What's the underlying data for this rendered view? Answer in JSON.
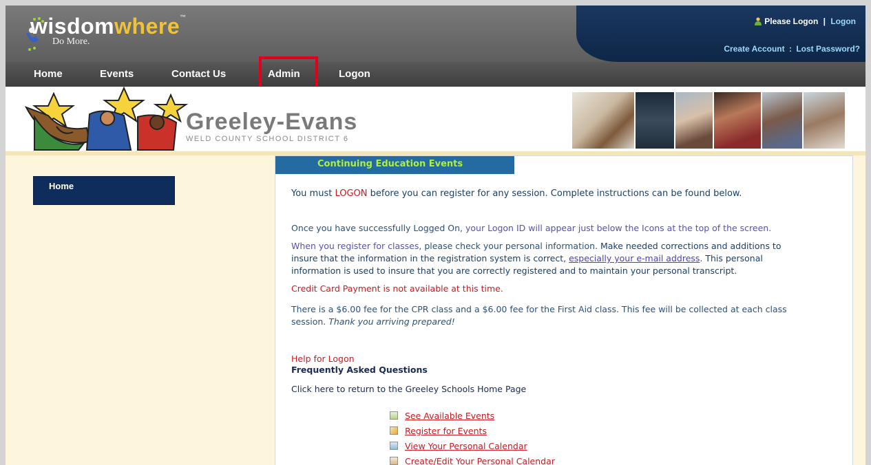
{
  "header": {
    "logo_word1": "wisdom",
    "logo_word2": "where",
    "logo_tm": "™",
    "logo_tagline": "Do More.",
    "please_logon": "Please Logon",
    "separator": "|",
    "logon_link": "Logon",
    "create_account": "Create Account",
    "colon": ":",
    "lost_password": "Lost Password?"
  },
  "nav": {
    "items": [
      "Home",
      "Events",
      "Contact Us",
      "Admin",
      "Logon"
    ]
  },
  "banner": {
    "district_name": "Greeley-Evans",
    "district_sub": "WELD COUNTY SCHOOL DISTRICT 6"
  },
  "sidebar": {
    "home": "Home"
  },
  "content": {
    "tab": "Continuing Education Events",
    "logon_pre": "You must ",
    "logon_word": "LOGON",
    "logon_post": " before you can register for any session. Complete instructions can be found below.",
    "logged_pre": "Once you have successfully Logged On, ",
    "logged_highlight": "your Logon ID will appear just below the Icons at the top of the screen.",
    "register_a": "When you register for classes",
    "register_b": ", please check your personal information",
    "register_c": ". Make needed corrections and additions to",
    "register_line2_pre": "insure that the information in the registration system is correct, ",
    "register_link": "especially your e-mail address",
    "register_line2_post": ". This personal",
    "register_line3": "information is used to insure that you are correctly registered and to maintain your personal transcript.",
    "credit_card": "Credit Card Payment is not available at this time.",
    "fee_line1": "There is a $6.00 fee for the CPR class and a $6.00 fee for the First Aid class. This fee will be collected at each class",
    "fee_line2_pre": "session. ",
    "fee_line2_italic": "Thank you arriving prepared!",
    "help_logon": "Help for Logon",
    "faq": "Frequently Asked Questions",
    "return_home": "Click here to return to the Greeley Schools Home Page",
    "links": [
      "See Available Events",
      "Register for Events",
      "View Your Personal Calendar",
      "Create/Edit Your Personal Calendar"
    ]
  },
  "colors": {
    "nav_bg": "#4a4a4a",
    "header_panel": "#133159",
    "tab_bg": "#236ba0",
    "tab_text": "#aef03e",
    "highlight_box": "#e3001b",
    "sidebar_home_bg": "#0e2d5c"
  },
  "icons": [
    "user-icon",
    "events-list-icon",
    "register-pencil-icon",
    "calendar-add-icon",
    "calendar-edit-icon"
  ]
}
